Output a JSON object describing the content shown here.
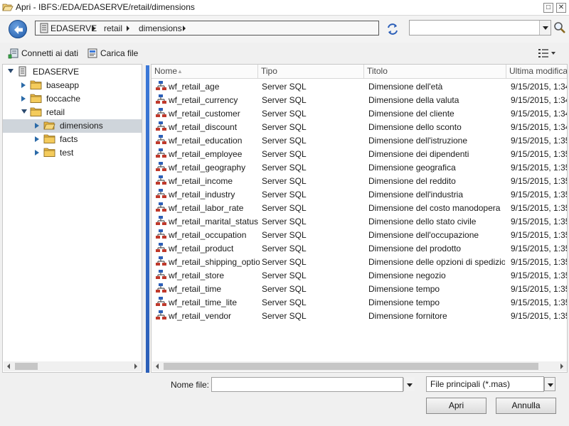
{
  "window": {
    "title": "Apri - IBFS:/EDA/EDASERVE/retail/dimensions",
    "minimize_glyph": "□",
    "close_glyph": "✕"
  },
  "breadcrumb": [
    "EDASERVE",
    "retail",
    "dimensions"
  ],
  "search": {
    "value": "",
    "placeholder": ""
  },
  "toolbar": {
    "connect_label": "Connetti ai dati",
    "upload_label": "Carica file"
  },
  "tree": [
    {
      "label": "EDASERVE",
      "depth": 0,
      "state": "expanded",
      "icon": "server-icon",
      "selected": false
    },
    {
      "label": "baseapp",
      "depth": 1,
      "state": "collapsed",
      "icon": "folder-icon",
      "selected": false
    },
    {
      "label": "foccache",
      "depth": 1,
      "state": "collapsed",
      "icon": "folder-icon",
      "selected": false
    },
    {
      "label": "retail",
      "depth": 1,
      "state": "expanded",
      "icon": "folder-icon",
      "selected": false
    },
    {
      "label": "dimensions",
      "depth": 2,
      "state": "collapsed",
      "icon": "folder-open-icon",
      "selected": true
    },
    {
      "label": "facts",
      "depth": 2,
      "state": "collapsed",
      "icon": "folder-icon",
      "selected": false
    },
    {
      "label": "test",
      "depth": 2,
      "state": "collapsed",
      "icon": "folder-icon",
      "selected": false
    }
  ],
  "columns": {
    "name": "Nome",
    "type": "Tipo",
    "title": "Titolo",
    "modified": "Ultima modifica"
  },
  "files": [
    {
      "name": "wf_retail_age",
      "type": "Server SQL",
      "title": "Dimensione dell'età",
      "modified": "9/15/2015, 1:34"
    },
    {
      "name": "wf_retail_currency",
      "type": "Server SQL",
      "title": "Dimensione della valuta",
      "modified": "9/15/2015, 1:34"
    },
    {
      "name": "wf_retail_customer",
      "type": "Server SQL",
      "title": "Dimensione del cliente",
      "modified": "9/15/2015, 1:34"
    },
    {
      "name": "wf_retail_discount",
      "type": "Server SQL",
      "title": "Dimensione dello sconto",
      "modified": "9/15/2015, 1:34"
    },
    {
      "name": "wf_retail_education",
      "type": "Server SQL",
      "title": "Dimensione dell'istruzione",
      "modified": "9/15/2015, 1:35"
    },
    {
      "name": "wf_retail_employee",
      "type": "Server SQL",
      "title": "Dimensione dei dipendenti",
      "modified": "9/15/2015, 1:35"
    },
    {
      "name": "wf_retail_geography",
      "type": "Server SQL",
      "title": "Dimensione geografica",
      "modified": "9/15/2015, 1:35"
    },
    {
      "name": "wf_retail_income",
      "type": "Server SQL",
      "title": "Dimensione del reddito",
      "modified": "9/15/2015, 1:35"
    },
    {
      "name": "wf_retail_industry",
      "type": "Server SQL",
      "title": "Dimensione dell'industria",
      "modified": "9/15/2015, 1:35"
    },
    {
      "name": "wf_retail_labor_rate",
      "type": "Server SQL",
      "title": "Dimensione del costo manodopera",
      "modified": "9/15/2015, 1:35"
    },
    {
      "name": "wf_retail_marital_status",
      "type": "Server SQL",
      "title": "Dimensione dello stato civile",
      "modified": "9/15/2015, 1:35"
    },
    {
      "name": "wf_retail_occupation",
      "type": "Server SQL",
      "title": "Dimensione dell'occupazione",
      "modified": "9/15/2015, 1:35"
    },
    {
      "name": "wf_retail_product",
      "type": "Server SQL",
      "title": "Dimensione del prodotto",
      "modified": "9/15/2015, 1:35"
    },
    {
      "name": "wf_retail_shipping_option",
      "type": "Server SQL",
      "title": "Dimensione delle opzioni di spedizione",
      "modified": "9/15/2015, 1:35"
    },
    {
      "name": "wf_retail_store",
      "type": "Server SQL",
      "title": "Dimensione negozio",
      "modified": "9/15/2015, 1:35"
    },
    {
      "name": "wf_retail_time",
      "type": "Server SQL",
      "title": "Dimensione tempo",
      "modified": "9/15/2015, 1:35"
    },
    {
      "name": "wf_retail_time_lite",
      "type": "Server SQL",
      "title": "Dimensione tempo",
      "modified": "9/15/2015, 1:35"
    },
    {
      "name": "wf_retail_vendor",
      "type": "Server SQL",
      "title": "Dimensione fornitore",
      "modified": "9/15/2015, 1:35"
    }
  ],
  "footer": {
    "filename_label": "Nome file:",
    "filename_value": "",
    "filter_value": "File principali (*.mas)",
    "open_label": "Apri",
    "cancel_label": "Annulla"
  },
  "colors": {
    "accent": "#2c5fb8",
    "selection": "#cfd5db",
    "folder": "#e9b640"
  }
}
